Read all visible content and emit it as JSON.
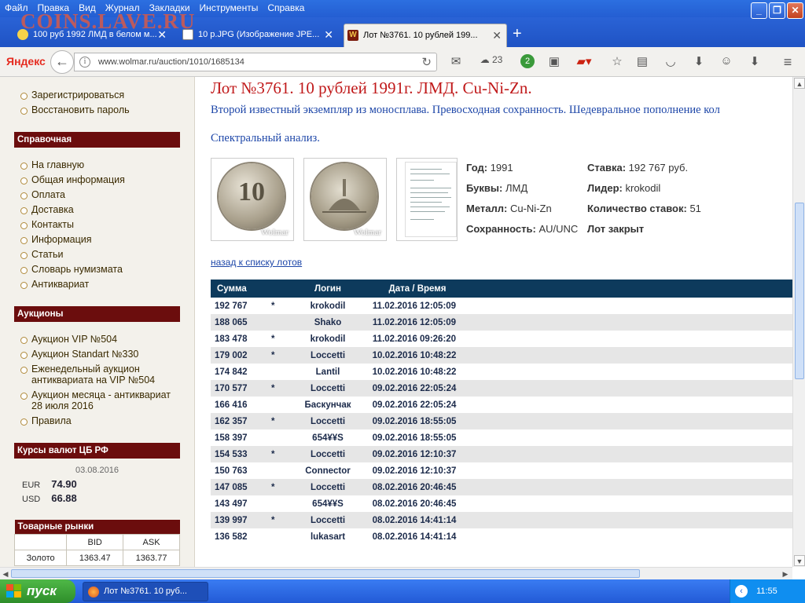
{
  "browser": {
    "menu": [
      "Файл",
      "Правка",
      "Вид",
      "Журнал",
      "Закладки",
      "Инструменты",
      "Справка"
    ],
    "watermark": "COINS.LAVE.RU",
    "tabs": [
      {
        "title": "100 руб 1992 ЛМД в белом м...",
        "icon": "smiley-icon"
      },
      {
        "title": "10 р.JPG (Изображение JPE...",
        "icon": "image-icon"
      },
      {
        "title": "Лот №3761. 10 рублей 199...",
        "icon": "wolmar-icon"
      }
    ],
    "yandex_logo": "Яндекс",
    "url": "www.wolmar.ru/auction/1010/1685134",
    "weather_temp": "23",
    "badge_count": "2"
  },
  "sidebar": {
    "account_links": [
      "Зарегистрироваться",
      "Восстановить пароль"
    ],
    "reference_title": "Справочная",
    "reference_links": [
      "На главную",
      "Общая информация",
      "Оплата",
      "Доставка",
      "Контакты",
      "Информация",
      "Статьи",
      "Словарь нумизмата",
      "Антиквариат"
    ],
    "auctions_title": "Аукционы",
    "auction_links": [
      "Аукцион VIP №504",
      "Аукцион Standart №330",
      "Еженедельный аукцион антиквариата на VIP №504",
      "Аукцион месяца - антиквариат 28 июля 2016",
      "Правила"
    ],
    "rates_title": "Курсы валют ЦБ РФ",
    "rates_date": "03.08.2016",
    "rates": [
      {
        "code": "EUR",
        "value": "74.90"
      },
      {
        "code": "USD",
        "value": "66.88"
      }
    ],
    "markets_title": "Товарные рынки",
    "markets_headers": [
      "",
      "BID",
      "ASK"
    ],
    "markets_rows": [
      [
        "Золото",
        "1363.47",
        "1363.77"
      ]
    ]
  },
  "lot": {
    "title": "Лот №3761.  10 рублей 1991г. ЛМД. Cu-Ni-Zn.",
    "description": "Второй известный экземпляр из моносплава. Превосходная сохранность. Шедевральное пополнение кол",
    "spectral_link": "Спектральный анализ.",
    "coin_denomination": "10",
    "thumb_watermark": "Wolmar",
    "specs_left": [
      {
        "label": "Год:",
        "value": "1991"
      },
      {
        "label": "Буквы:",
        "value": "ЛМД"
      },
      {
        "label": "Металл:",
        "value": "Cu-Ni-Zn"
      },
      {
        "label": "Сохранность:",
        "value": "AU/UNC"
      }
    ],
    "specs_right": [
      {
        "label": "Ставка:",
        "value": "192 767 руб."
      },
      {
        "label": "Лидер:",
        "value": "krokodil"
      },
      {
        "label": "Количество ставок:",
        "value": "51"
      },
      {
        "label": "Лот закрыт",
        "value": ""
      }
    ],
    "back_link": "назад к списку лотов"
  },
  "bids": {
    "headers": [
      "Сумма",
      "Логин",
      "Дата / Время"
    ],
    "rows": [
      {
        "amount": "192 767",
        "star": "*",
        "login": "krokodil",
        "datetime": "11.02.2016 12:05:09"
      },
      {
        "amount": "188 065",
        "star": "",
        "login": "Shako",
        "datetime": "11.02.2016 12:05:09"
      },
      {
        "amount": "183 478",
        "star": "*",
        "login": "krokodil",
        "datetime": "11.02.2016 09:26:20"
      },
      {
        "amount": "179 002",
        "star": "*",
        "login": "Loccetti",
        "datetime": "10.02.2016 10:48:22"
      },
      {
        "amount": "174 842",
        "star": "",
        "login": "Lantil",
        "datetime": "10.02.2016 10:48:22"
      },
      {
        "amount": "170 577",
        "star": "*",
        "login": "Loccetti",
        "datetime": "09.02.2016 22:05:24"
      },
      {
        "amount": "166 416",
        "star": "",
        "login": "Баскунчак",
        "datetime": "09.02.2016 22:05:24"
      },
      {
        "amount": "162 357",
        "star": "*",
        "login": "Loccetti",
        "datetime": "09.02.2016 18:55:05"
      },
      {
        "amount": "158 397",
        "star": "",
        "login": "654¥¥S",
        "datetime": "09.02.2016 18:55:05"
      },
      {
        "amount": "154 533",
        "star": "*",
        "login": "Loccetti",
        "datetime": "09.02.2016 12:10:37"
      },
      {
        "amount": "150 763",
        "star": "",
        "login": "Connector",
        "datetime": "09.02.2016 12:10:37"
      },
      {
        "amount": "147 085",
        "star": "*",
        "login": "Loccetti",
        "datetime": "08.02.2016 20:46:45"
      },
      {
        "amount": "143 497",
        "star": "",
        "login": "654¥¥S",
        "datetime": "08.02.2016 20:46:45"
      },
      {
        "amount": "139 997",
        "star": "*",
        "login": "Loccetti",
        "datetime": "08.02.2016 14:41:14"
      },
      {
        "amount": "136 582",
        "star": "",
        "login": "lukasart",
        "datetime": "08.02.2016 14:41:14"
      }
    ]
  },
  "taskbar": {
    "start_label": "пуск",
    "task_title": "Лот №3761. 10 руб...",
    "language": "EN",
    "clock": "11:55"
  }
}
